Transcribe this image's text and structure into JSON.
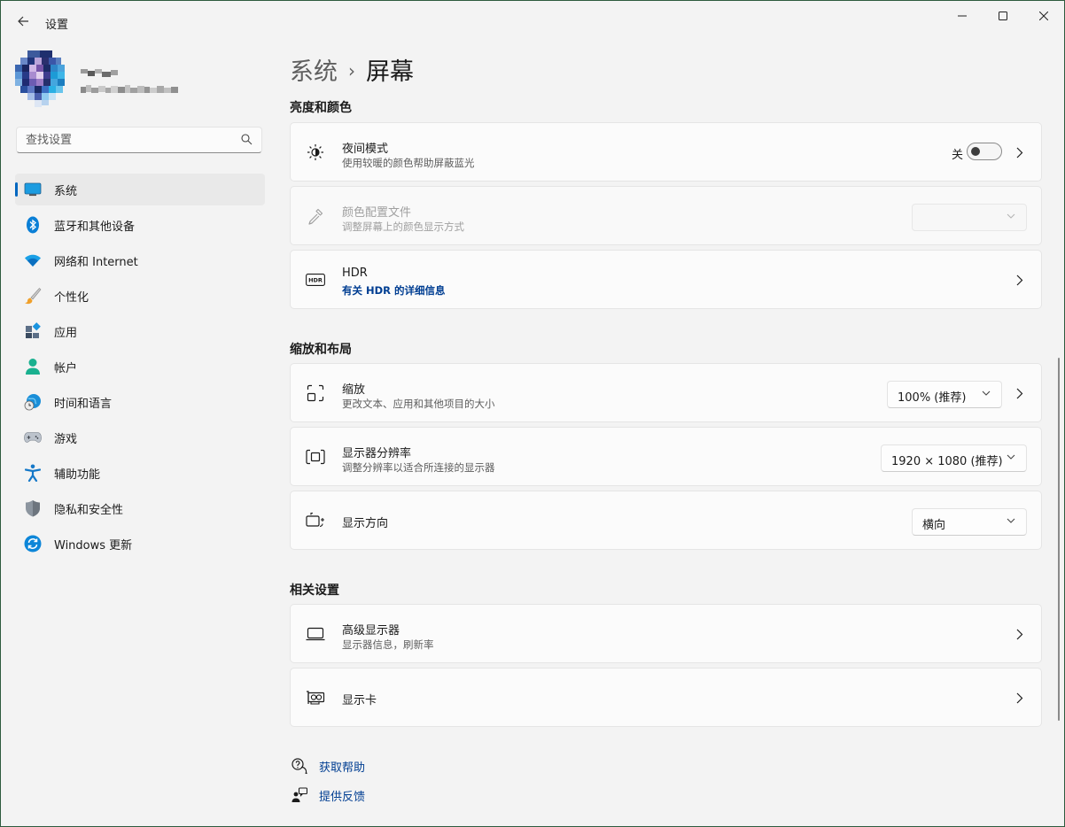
{
  "window": {
    "app_title": "设置",
    "minimize_icon": "minimize-icon",
    "maximize_icon": "maximize-icon",
    "close_icon": "close-icon"
  },
  "search": {
    "placeholder": "查找设置"
  },
  "sidebar": {
    "items": [
      {
        "label": "系统",
        "icon": "system-monitor-icon",
        "active": true
      },
      {
        "label": "蓝牙和其他设备",
        "icon": "bluetooth-icon"
      },
      {
        "label": "网络和 Internet",
        "icon": "wifi-icon"
      },
      {
        "label": "个性化",
        "icon": "brush-icon"
      },
      {
        "label": "应用",
        "icon": "apps-icon"
      },
      {
        "label": "帐户",
        "icon": "account-icon"
      },
      {
        "label": "时间和语言",
        "icon": "globe-clock-icon"
      },
      {
        "label": "游戏",
        "icon": "gamepad-icon"
      },
      {
        "label": "辅助功能",
        "icon": "accessibility-icon"
      },
      {
        "label": "隐私和安全性",
        "icon": "shield-icon"
      },
      {
        "label": "Windows 更新",
        "icon": "update-icon"
      }
    ]
  },
  "breadcrumb": {
    "parent": "系统",
    "separator": "›",
    "current": "屏幕"
  },
  "sections": {
    "brightness": {
      "title": "亮度和颜色",
      "night_light": {
        "title": "夜间模式",
        "subtitle": "使用较暖的颜色帮助屏蔽蓝光",
        "toggle_label": "关",
        "toggle_on": false
      },
      "color_profile": {
        "title": "颜色配置文件",
        "subtitle": "调整屏幕上的颜色显示方式",
        "value": ""
      },
      "hdr": {
        "title": "HDR",
        "link": "有关 HDR 的详细信息"
      }
    },
    "scale_layout": {
      "title": "缩放和布局",
      "scale": {
        "title": "缩放",
        "subtitle": "更改文本、应用和其他项目的大小",
        "value": "100% (推荐)"
      },
      "resolution": {
        "title": "显示器分辨率",
        "subtitle": "调整分辨率以适合所连接的显示器",
        "value": "1920 × 1080 (推荐)"
      },
      "orientation": {
        "title": "显示方向",
        "value": "横向"
      }
    },
    "related": {
      "title": "相关设置",
      "advanced_display": {
        "title": "高级显示器",
        "subtitle": "显示器信息，刷新率"
      },
      "graphics": {
        "title": "显示卡"
      }
    }
  },
  "footer": {
    "help": "获取帮助",
    "feedback": "提供反馈"
  },
  "colors": {
    "accent": "#0067c0",
    "link": "#003e92",
    "background": "#f3f3f3",
    "card": "#fbfbfb"
  }
}
